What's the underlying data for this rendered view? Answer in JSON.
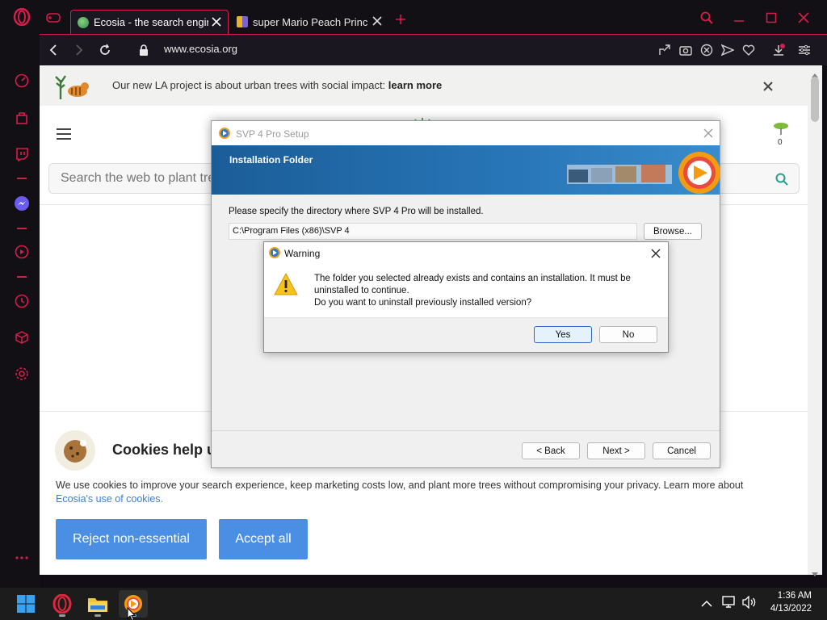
{
  "tabs": [
    {
      "title": "Ecosia - the search engine that plants trees",
      "active": true,
      "favicon_color": "#4caf50"
    },
    {
      "title": "super Mario Peach Princess",
      "active": false,
      "favicon_color": "#e8b32a"
    }
  ],
  "address": {
    "url": "www.ecosia.org"
  },
  "banner": {
    "text": "Our new LA project is about urban trees with social impact:",
    "link": "learn more"
  },
  "tree_counter": "0",
  "search": {
    "placeholder": "Search the web to plant trees..."
  },
  "cookies": {
    "title": "Cookies help us",
    "text": "We use cookies to improve your search experience, keep marketing costs low, and plant more trees without compromising your privacy. Learn more about",
    "link": "Ecosia's use of cookies.",
    "reject_label": "Reject non-essential",
    "accept_label": "Accept all"
  },
  "setup_dialog": {
    "title": "SVP 4 Pro Setup",
    "header": "Installation Folder",
    "instruction": "Please specify the directory where SVP 4 Pro will be installed.",
    "path_value": "C:\\Program Files (x86)\\SVP 4",
    "browse_label": "Browse...",
    "back_label": "< Back",
    "next_label": "Next >",
    "cancel_label": "Cancel"
  },
  "warning_dialog": {
    "title": "Warning",
    "line1": "The folder you selected already exists and contains an installation. It must be",
    "line2": "uninstalled to continue.",
    "line3": "Do you want to uninstall previously installed version?",
    "yes_label": "Yes",
    "no_label": "No"
  },
  "taskbar": {
    "time": "1:36 AM",
    "date": "4/13/2022"
  },
  "colors": {
    "opera_red": "#d81d4b",
    "ecosia_blue": "#4a8fe4",
    "svp_blue": "#1b5d98"
  }
}
